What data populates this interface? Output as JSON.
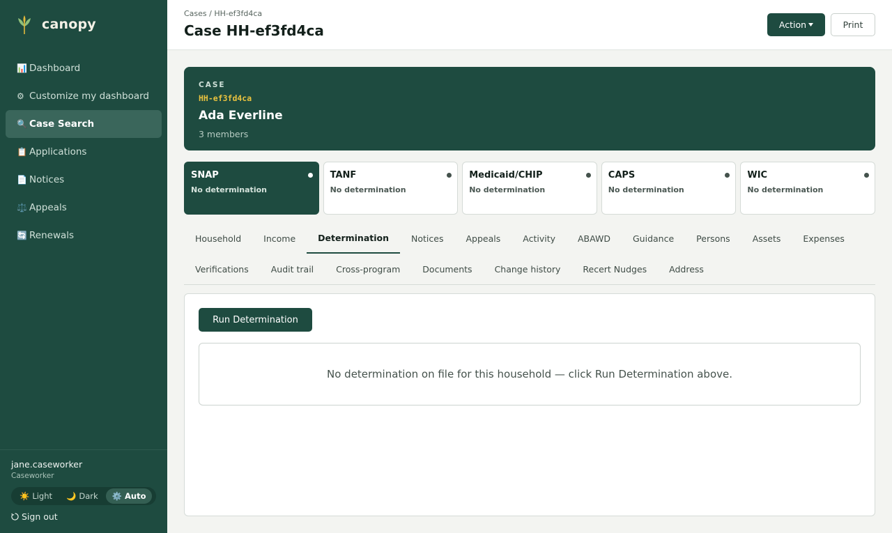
{
  "brand": {
    "name": "canopy"
  },
  "sidebar": {
    "items": [
      {
        "icon": "📊",
        "label": "Dashboard",
        "active": false
      },
      {
        "icon": "⚙",
        "label": "Customize my dashboard",
        "active": false
      },
      {
        "icon": "🔍",
        "label": "Case Search",
        "active": true
      },
      {
        "icon": "📋",
        "label": "Applications",
        "active": false
      },
      {
        "icon": "📄",
        "label": "Notices",
        "active": false
      },
      {
        "icon": "⚖️",
        "label": "Appeals",
        "active": false
      },
      {
        "icon": "🔄",
        "label": "Renewals",
        "active": false
      }
    ],
    "user": {
      "name": "jane.caseworker",
      "role": "Caseworker"
    },
    "theme": {
      "options": [
        {
          "icon": "☀️",
          "label": "Light"
        },
        {
          "icon": "🌙",
          "label": "Dark"
        },
        {
          "icon": "⚙️",
          "label": "Auto"
        }
      ],
      "selected": "Auto"
    },
    "signout_label": "Sign out"
  },
  "header": {
    "breadcrumb": "Cases / HH-ef3fd4ca",
    "title": "Case HH-ef3fd4ca",
    "action_label": "Action",
    "print_label": "Print"
  },
  "case": {
    "label": "CASE",
    "id": "HH-ef3fd4ca",
    "name": "Ada Everline",
    "members": "3 members"
  },
  "programs": [
    {
      "name": "SNAP",
      "status": "No determination"
    },
    {
      "name": "TANF",
      "status": "No determination"
    },
    {
      "name": "Medicaid/CHIP",
      "status": "No determination"
    },
    {
      "name": "CAPS",
      "status": "No determination"
    },
    {
      "name": "WIC",
      "status": "No determination"
    }
  ],
  "tabs": {
    "row1": [
      "Household",
      "Income",
      "Determination",
      "Notices",
      "Appeals",
      "Activity",
      "ABAWD",
      "Guidance",
      "Persons",
      "Assets",
      "Expenses"
    ],
    "row2": [
      "Verifications",
      "Audit trail",
      "Cross-program",
      "Documents",
      "Change history",
      "Recert Nudges",
      "Address"
    ],
    "active": "Determination"
  },
  "determination": {
    "run_label": "Run Determination",
    "empty_text": "No determination on file for this household — click Run Determination above."
  },
  "colors": {
    "primary": "#1e4b40",
    "accent_id": "#e9c23f"
  }
}
